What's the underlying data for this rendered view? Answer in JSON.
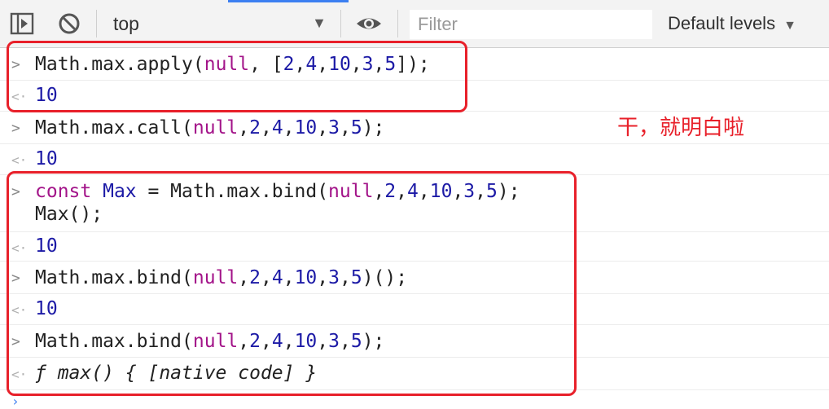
{
  "toolbar": {
    "context": "top",
    "filter_placeholder": "Filter",
    "levels_label": "Default levels"
  },
  "icons": {
    "sidebar": "toggle-sidebar-icon",
    "clear": "clear-console-icon",
    "eye": "live-expression-eye-icon"
  },
  "colors": {
    "annotation": "#e8202a",
    "keyword": "#a31489",
    "number": "#1c1aa6"
  },
  "console": {
    "entries": [
      {
        "input": {
          "p1": "Math.max.apply(",
          "kw": "null",
          "p2": ", [",
          "n1": "2",
          "c1": ",",
          "n2": "4",
          "c2": ",",
          "n3": "10",
          "c3": ",",
          "n4": "3",
          "c4": ",",
          "n5": "5",
          "p3": "]);"
        },
        "output": "10"
      },
      {
        "input": {
          "p1": "Math.max.call(",
          "kw": "null",
          "c0": ",",
          "n1": "2",
          "c1": ",",
          "n2": "4",
          "c2": ",",
          "n3": "10",
          "c3": ",",
          "n4": "3",
          "c4": ",",
          "n5": "5",
          "p3": ");"
        },
        "output": "10"
      },
      {
        "input": {
          "kw1": "const",
          "var": " Max",
          "p1": " = Math.max.bind(",
          "kw": "null",
          "c0": ",",
          "n1": "2",
          "c1": ",",
          "n2": "4",
          "c2": ",",
          "n3": "10",
          "c3": ",",
          "n4": "3",
          "c4": ",",
          "n5": "5",
          "p3": ");",
          "line2": "Max();"
        },
        "output": "10"
      },
      {
        "input": {
          "p1": "Math.max.bind(",
          "kw": "null",
          "c0": ",",
          "n1": "2",
          "c1": ",",
          "n2": "4",
          "c2": ",",
          "n3": "10",
          "c3": ",",
          "n4": "3",
          "c4": ",",
          "n5": "5",
          "p3": ")();"
        },
        "output": "10"
      },
      {
        "input": {
          "p1": "Math.max.bind(",
          "kw": "null",
          "c0": ",",
          "n1": "2",
          "c1": ",",
          "n2": "4",
          "c2": ",",
          "n3": "10",
          "c3": ",",
          "n4": "3",
          "c4": ",",
          "n5": "5",
          "p3": ");"
        },
        "output": "ƒ max() { [native code] }"
      }
    ]
  },
  "annotation": {
    "text": "干，就明白啦"
  }
}
